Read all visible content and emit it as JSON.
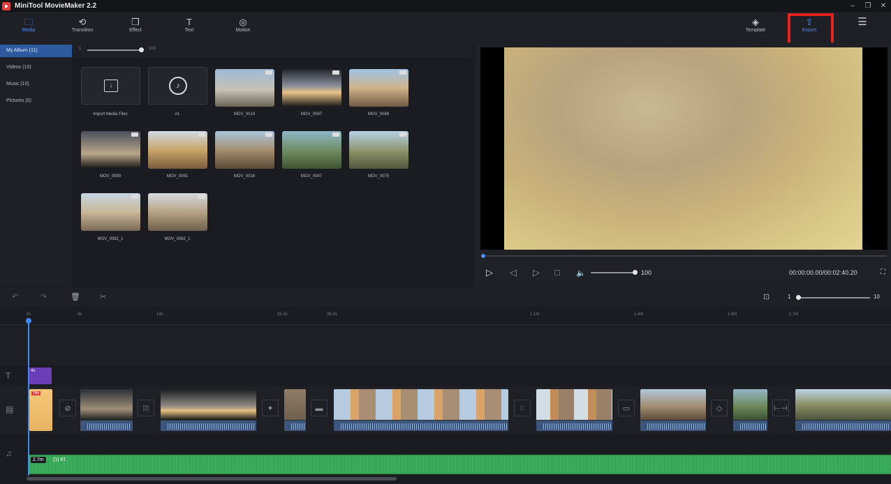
{
  "app": {
    "title": "MiniTool MovieMaker 2.2"
  },
  "toolbar": {
    "media": "Media",
    "transition": "Transition",
    "effect": "Effect",
    "text": "Text",
    "motion": "Motion",
    "template": "Template",
    "export": "Export"
  },
  "sidebar": {
    "items": [
      {
        "label": "My Album (11)"
      },
      {
        "label": "Videos (10)"
      },
      {
        "label": "Music (10)"
      },
      {
        "label": "Pictures (0)"
      }
    ]
  },
  "media_zoom": {
    "min": "1",
    "max": "100"
  },
  "media": {
    "items": [
      {
        "label": "Import Media Files"
      },
      {
        "label": "#1"
      },
      {
        "label": "MOV_0014"
      },
      {
        "label": "MOV_0087"
      },
      {
        "label": "MOV_0088"
      },
      {
        "label": "MOV_0090"
      },
      {
        "label": "MOV_0091"
      },
      {
        "label": "MOV_0016"
      },
      {
        "label": "MOV_0047"
      },
      {
        "label": "MOV_0075"
      },
      {
        "label": "MOV_0082_1"
      },
      {
        "label": "MOV_0082_1"
      }
    ]
  },
  "player": {
    "volume": "100",
    "timecode": "00:00:00.00/00:02:40.20",
    "progress": 0.0
  },
  "timeline": {
    "ruler_ticks": [
      "0s",
      "4s",
      "14s",
      "31.5s",
      "36.2s",
      "1.1m",
      "1.4m",
      "1.6m",
      "1.7m"
    ],
    "zoom_min": "1",
    "zoom_max": "10",
    "text_clip": "4s",
    "title_clip_tag": "Title",
    "audio_length": "2.7m",
    "audio_name": "(1) #1"
  },
  "colors": {
    "accent": "#4c8df6",
    "export_highlight": "#e8231f",
    "audio": "#2f9a4e"
  }
}
